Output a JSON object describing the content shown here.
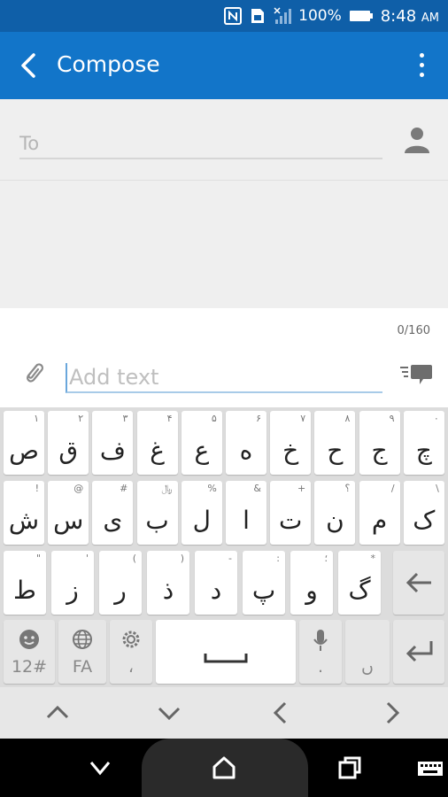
{
  "status_bar": {
    "battery_percent": "100%",
    "time": "8:48",
    "am_pm": "AM",
    "icons": [
      "nfc-icon",
      "sim-icon",
      "signal-icon",
      "battery-icon"
    ]
  },
  "app_bar": {
    "title": "Compose",
    "color": "#1275c9"
  },
  "compose": {
    "to_placeholder": "To",
    "message_placeholder": "Add text",
    "char_counter": "0/160"
  },
  "keyboard": {
    "row1": [
      {
        "char": "ص",
        "hint": "۱"
      },
      {
        "char": "ق",
        "hint": "۲"
      },
      {
        "char": "ف",
        "hint": "۳"
      },
      {
        "char": "غ",
        "hint": "۴"
      },
      {
        "char": "ع",
        "hint": "۵"
      },
      {
        "char": "ه",
        "hint": "۶"
      },
      {
        "char": "خ",
        "hint": "۷"
      },
      {
        "char": "ح",
        "hint": "۸"
      },
      {
        "char": "ج",
        "hint": "۹"
      },
      {
        "char": "چ",
        "hint": "۰"
      }
    ],
    "row2": [
      {
        "char": "ش",
        "hint": "!"
      },
      {
        "char": "س",
        "hint": "@"
      },
      {
        "char": "ی",
        "hint": "#"
      },
      {
        "char": "ب",
        "hint": "﷼"
      },
      {
        "char": "ل",
        "hint": "%"
      },
      {
        "char": "ا",
        "hint": "&"
      },
      {
        "char": "ت",
        "hint": "+"
      },
      {
        "char": "ن",
        "hint": "؟"
      },
      {
        "char": "م",
        "hint": "/"
      },
      {
        "char": "ک",
        "hint": "\\"
      }
    ],
    "row3": [
      {
        "char": "ط",
        "hint": "\""
      },
      {
        "char": "ز",
        "hint": "'"
      },
      {
        "char": "ر",
        "hint": "("
      },
      {
        "char": "ذ",
        "hint": ")"
      },
      {
        "char": "د",
        "hint": "-"
      },
      {
        "char": "پ",
        "hint": ":"
      },
      {
        "char": "و",
        "hint": "؛"
      },
      {
        "char": "گ",
        "hint": "*"
      }
    ],
    "row4": {
      "symbols_label": "12#",
      "language_label": "FA",
      "settings_sub": "،",
      "mic_sub": ".",
      "zwnj_sub": "ں"
    }
  }
}
